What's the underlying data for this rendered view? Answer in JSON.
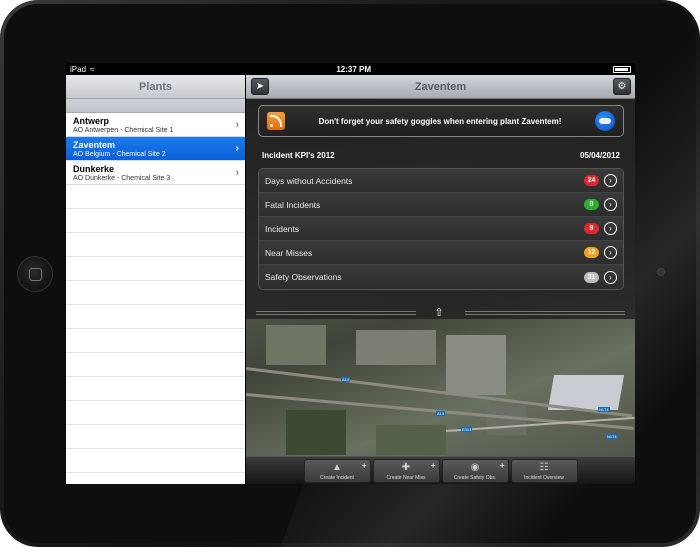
{
  "status_bar": {
    "carrier": "iPad",
    "time": "12:37 PM"
  },
  "left_pane": {
    "title": "Plants",
    "plants": [
      {
        "name": "Antwerp",
        "subtitle": "AO Antwerpen - Chemical Site 1"
      },
      {
        "name": "Zaventem",
        "subtitle": "AO Belgium - Chemical Site 2"
      },
      {
        "name": "Dunkerke",
        "subtitle": "AO Dunkerke - Chemical Site 3"
      }
    ]
  },
  "right_pane": {
    "title": "Zaventem",
    "banner": {
      "text": "Don't forget your safety goggles when entering plant Zaventem!"
    },
    "kpi": {
      "title": "Incident KPI's 2012",
      "date": "05/04/2012",
      "rows": [
        {
          "label": "Days without Accidents",
          "value": "24",
          "color": "#e0262e"
        },
        {
          "label": "Fatal Incidents",
          "value": "0",
          "color": "#2fae2b"
        },
        {
          "label": "Incidents",
          "value": "9",
          "color": "#e0262e"
        },
        {
          "label": "Near Misses",
          "value": "12",
          "color": "#f0a21d"
        },
        {
          "label": "Safety Observations",
          "value": "31",
          "color": "#bdbdbd"
        }
      ]
    },
    "map_labels": [
      "A13",
      "A13",
      "E313",
      "N174",
      "N174"
    ],
    "toolbar": [
      {
        "label": "Create Incident",
        "icon": "warning-icon"
      },
      {
        "label": "Create Near Miss",
        "icon": "first-aid-icon"
      },
      {
        "label": "Create Safety Obs.",
        "icon": "eye-icon"
      },
      {
        "label": "Incident Overview",
        "icon": "document-icon"
      }
    ]
  }
}
